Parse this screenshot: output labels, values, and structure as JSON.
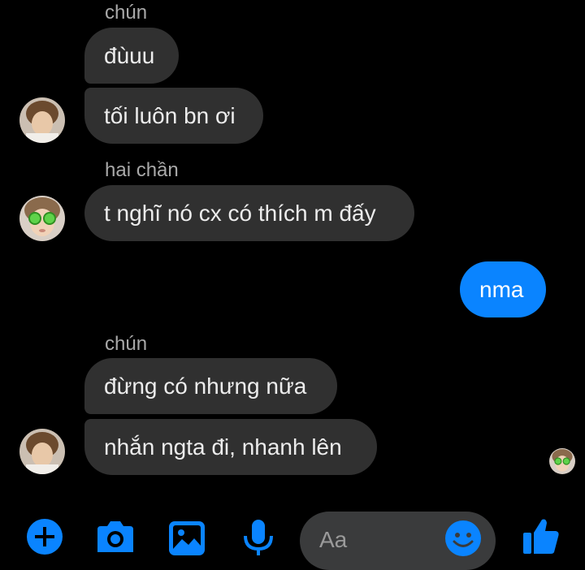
{
  "messages": [
    {
      "sender": "chún"
    },
    {
      "text": "đùuu"
    },
    {
      "text": "tối luôn bn ơi"
    },
    {
      "sender": "hai chần"
    },
    {
      "text": "t nghĩ nó cx có thích m đấy"
    },
    {
      "text": "nma"
    },
    {
      "sender": "chún"
    },
    {
      "text": "đừng có nhưng nữa"
    },
    {
      "text": "nhắn ngta đi, nhanh lên"
    }
  ],
  "composer": {
    "placeholder": "Aa",
    "icons": [
      "plus-icon",
      "camera-icon",
      "image-icon",
      "microphone-icon",
      "emoji-icon",
      "like-icon"
    ]
  },
  "colors": {
    "background": "#000000",
    "incoming_bubble": "#303030",
    "outgoing_bubble": "#0a84ff",
    "accent": "#0a84ff"
  }
}
